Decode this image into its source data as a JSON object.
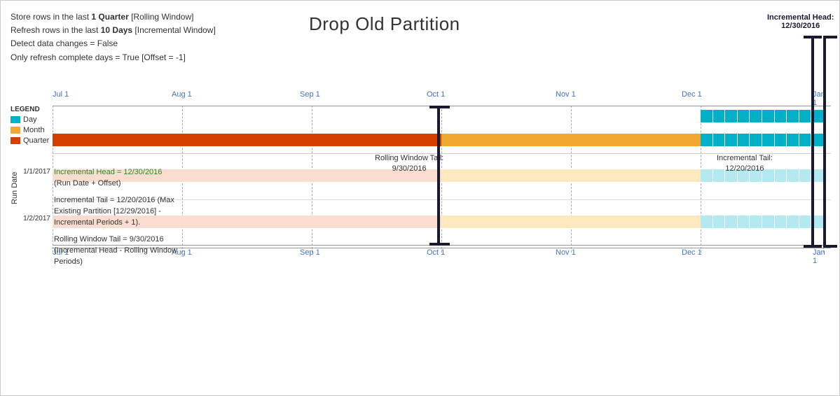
{
  "title": "Drop Old Partition",
  "info": {
    "line1_pre": "Store rows in the last ",
    "line1_bold": "1 Quarter",
    "line1_post": " [Rolling Window]",
    "line2_pre": "Refresh rows in the last ",
    "line2_bold": "10 Days",
    "line2_post": " [Incremental Window]",
    "line3": "Detect data changes = False",
    "line4": "Only refresh complete days = True [Offset = -1]"
  },
  "legend": {
    "title": "LEGEND",
    "items": [
      {
        "label": "Day",
        "color": "#00b0c8"
      },
      {
        "label": "Month",
        "color": "#f0a830"
      },
      {
        "label": "Quarter",
        "color": "#d44000"
      }
    ]
  },
  "xaxis": {
    "labels": [
      "Jul 1",
      "Aug 1",
      "Sep 1",
      "Oct 1",
      "Nov 1",
      "Dec 1",
      "Jan 1"
    ]
  },
  "annotations": {
    "inc_head": {
      "label": "Incremental Head:",
      "value": "12/30/2016"
    },
    "rolling_tail": {
      "label": "Rolling Window Tail:",
      "value": "9/30/2016"
    },
    "inc_tail": {
      "label": "Incremental Tail:",
      "value": "12/20/2016"
    }
  },
  "run_date_label": "Run Date",
  "row_labels": [
    "1/1/2017",
    "1/2/2017"
  ],
  "left_annotations": {
    "block1_title": "Incremental Head = 12/30/2016",
    "block1_sub": "(Run Date + Offset)",
    "block2_title": "Incremental Tail = 12/20/2016 (Max Existing Partition [12/29/2016] - Incremental Periods + 1).",
    "block3_title": "Rolling Window Tail = 9/30/2016 (Incremental Head - Rolling Window Periods)"
  }
}
